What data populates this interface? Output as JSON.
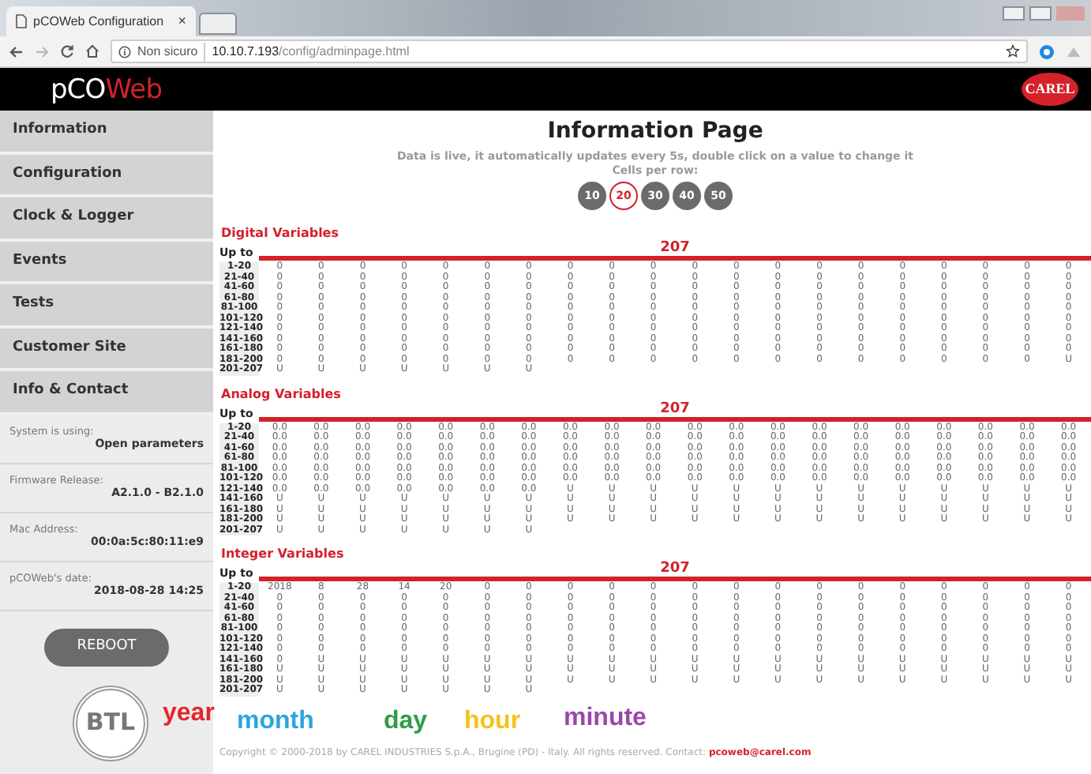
{
  "browser": {
    "tab_title": "pCOWeb Configuration",
    "tab_close": "×",
    "security_label": "Non sicuro",
    "url_host": "10.10.7.193",
    "url_path": "/config/adminpage.html"
  },
  "header": {
    "logo_part_1": "pCO",
    "logo_part_2": "Web",
    "brand_logo": "CAREL"
  },
  "sidebar": {
    "menu": [
      "Information",
      "Configuration",
      "Clock & Logger",
      "Events",
      "Tests",
      "Customer Site",
      "Info & Contact"
    ],
    "info": [
      {
        "label": "System is using:",
        "value": "Open parameters"
      },
      {
        "label": "Firmware Release:",
        "value": "A2.1.0 - B2.1.0"
      },
      {
        "label": "Mac Address:",
        "value": "00:0a:5c:80:11:e9"
      },
      {
        "label": "pCOWeb's date:",
        "value": "2018-08-28 14:25"
      }
    ],
    "reboot_button": "REBOOT",
    "badge_text": "BTL"
  },
  "page": {
    "title": "Information Page",
    "subtitle": "Data is live, it automatically updates every 5s, double click on a value to change it",
    "cells_label": "Cells per row:",
    "cells_per_row": [
      {
        "label": "10",
        "selected": false
      },
      {
        "label": "20",
        "selected": true
      },
      {
        "label": "30",
        "selected": false
      },
      {
        "label": "40",
        "selected": false
      },
      {
        "label": "50",
        "selected": false
      }
    ]
  },
  "tables": [
    {
      "title": "Digital Variables",
      "header_label": "Up to",
      "count": "207",
      "rows": [
        {
          "label": "1-20",
          "values": [
            "0",
            "0",
            "0",
            "0",
            "0",
            "0",
            "0",
            "0",
            "0",
            "0",
            "0",
            "0",
            "0",
            "0",
            "0",
            "0",
            "0",
            "0",
            "0",
            "0"
          ]
        },
        {
          "label": "21-40",
          "values": [
            "0",
            "0",
            "0",
            "0",
            "0",
            "0",
            "0",
            "0",
            "0",
            "0",
            "0",
            "0",
            "0",
            "0",
            "0",
            "0",
            "0",
            "0",
            "0",
            "0"
          ]
        },
        {
          "label": "41-60",
          "values": [
            "0",
            "0",
            "0",
            "0",
            "0",
            "0",
            "0",
            "0",
            "0",
            "0",
            "0",
            "0",
            "0",
            "0",
            "0",
            "0",
            "0",
            "0",
            "0",
            "0"
          ]
        },
        {
          "label": "61-80",
          "values": [
            "0",
            "0",
            "0",
            "0",
            "0",
            "0",
            "0",
            "0",
            "0",
            "0",
            "0",
            "0",
            "0",
            "0",
            "0",
            "0",
            "0",
            "0",
            "0",
            "0"
          ]
        },
        {
          "label": "81-100",
          "values": [
            "0",
            "0",
            "0",
            "0",
            "0",
            "0",
            "0",
            "0",
            "0",
            "0",
            "0",
            "0",
            "0",
            "0",
            "0",
            "0",
            "0",
            "0",
            "0",
            "0"
          ]
        },
        {
          "label": "101-120",
          "values": [
            "0",
            "0",
            "0",
            "0",
            "0",
            "0",
            "0",
            "0",
            "0",
            "0",
            "0",
            "0",
            "0",
            "0",
            "0",
            "0",
            "0",
            "0",
            "0",
            "0"
          ]
        },
        {
          "label": "121-140",
          "values": [
            "0",
            "0",
            "0",
            "0",
            "0",
            "0",
            "0",
            "0",
            "0",
            "0",
            "0",
            "0",
            "0",
            "0",
            "0",
            "0",
            "0",
            "0",
            "0",
            "0"
          ]
        },
        {
          "label": "141-160",
          "values": [
            "0",
            "0",
            "0",
            "0",
            "0",
            "0",
            "0",
            "0",
            "0",
            "0",
            "0",
            "0",
            "0",
            "0",
            "0",
            "0",
            "0",
            "0",
            "0",
            "0"
          ]
        },
        {
          "label": "161-180",
          "values": [
            "0",
            "0",
            "0",
            "0",
            "0",
            "0",
            "0",
            "0",
            "0",
            "0",
            "0",
            "0",
            "0",
            "0",
            "0",
            "0",
            "0",
            "0",
            "0",
            "0"
          ]
        },
        {
          "label": "181-200",
          "values": [
            "0",
            "0",
            "0",
            "0",
            "0",
            "0",
            "0",
            "0",
            "0",
            "0",
            "0",
            "0",
            "0",
            "0",
            "0",
            "0",
            "0",
            "0",
            "0",
            "U"
          ]
        },
        {
          "label": "201-207",
          "values": [
            "U",
            "U",
            "U",
            "U",
            "U",
            "U",
            "U"
          ]
        }
      ]
    },
    {
      "title": "Analog Variables",
      "header_label": "Up to",
      "count": "207",
      "rows": [
        {
          "label": "1-20",
          "values": [
            "0.0",
            "0.0",
            "0.0",
            "0.0",
            "0.0",
            "0.0",
            "0.0",
            "0.0",
            "0.0",
            "0.0",
            "0.0",
            "0.0",
            "0.0",
            "0.0",
            "0.0",
            "0.0",
            "0.0",
            "0.0",
            "0.0",
            "0.0"
          ]
        },
        {
          "label": "21-40",
          "values": [
            "0.0",
            "0.0",
            "0.0",
            "0.0",
            "0.0",
            "0.0",
            "0.0",
            "0.0",
            "0.0",
            "0.0",
            "0.0",
            "0.0",
            "0.0",
            "0.0",
            "0.0",
            "0.0",
            "0.0",
            "0.0",
            "0.0",
            "0.0"
          ]
        },
        {
          "label": "41-60",
          "values": [
            "0.0",
            "0.0",
            "0.0",
            "0.0",
            "0.0",
            "0.0",
            "0.0",
            "0.0",
            "0.0",
            "0.0",
            "0.0",
            "0.0",
            "0.0",
            "0.0",
            "0.0",
            "0.0",
            "0.0",
            "0.0",
            "0.0",
            "0.0"
          ]
        },
        {
          "label": "61-80",
          "values": [
            "0.0",
            "0.0",
            "0.0",
            "0.0",
            "0.0",
            "0.0",
            "0.0",
            "0.0",
            "0.0",
            "0.0",
            "0.0",
            "0.0",
            "0.0",
            "0.0",
            "0.0",
            "0.0",
            "0.0",
            "0.0",
            "0.0",
            "0.0"
          ]
        },
        {
          "label": "81-100",
          "values": [
            "0.0",
            "0.0",
            "0.0",
            "0.0",
            "0.0",
            "0.0",
            "0.0",
            "0.0",
            "0.0",
            "0.0",
            "0.0",
            "0.0",
            "0.0",
            "0.0",
            "0.0",
            "0.0",
            "0.0",
            "0.0",
            "0.0",
            "0.0"
          ]
        },
        {
          "label": "101-120",
          "values": [
            "0.0",
            "0.0",
            "0.0",
            "0.0",
            "0.0",
            "0.0",
            "0.0",
            "0.0",
            "0.0",
            "0.0",
            "0.0",
            "0.0",
            "0.0",
            "0.0",
            "0.0",
            "0.0",
            "0.0",
            "0.0",
            "0.0",
            "0.0"
          ]
        },
        {
          "label": "121-140",
          "values": [
            "0.0",
            "0.0",
            "0.0",
            "0.0",
            "0.0",
            "0.0",
            "0.0",
            "U",
            "U",
            "U",
            "U",
            "U",
            "U",
            "U",
            "U",
            "U",
            "U",
            "U",
            "U",
            "U"
          ]
        },
        {
          "label": "141-160",
          "values": [
            "U",
            "U",
            "U",
            "U",
            "U",
            "U",
            "U",
            "U",
            "U",
            "U",
            "U",
            "U",
            "U",
            "U",
            "U",
            "U",
            "U",
            "U",
            "U",
            "U"
          ]
        },
        {
          "label": "161-180",
          "values": [
            "U",
            "U",
            "U",
            "U",
            "U",
            "U",
            "U",
            "U",
            "U",
            "U",
            "U",
            "U",
            "U",
            "U",
            "U",
            "U",
            "U",
            "U",
            "U",
            "U"
          ]
        },
        {
          "label": "181-200",
          "values": [
            "U",
            "U",
            "U",
            "U",
            "U",
            "U",
            "U",
            "U",
            "U",
            "U",
            "U",
            "U",
            "U",
            "U",
            "U",
            "U",
            "U",
            "U",
            "U",
            "U"
          ]
        },
        {
          "label": "201-207",
          "values": [
            "U",
            "U",
            "U",
            "U",
            "U",
            "U",
            "U"
          ]
        }
      ]
    },
    {
      "title": "Integer Variables",
      "header_label": "Up to",
      "count": "207",
      "rows": [
        {
          "label": "1-20",
          "values": [
            "2018",
            "8",
            "28",
            "14",
            "20",
            "0",
            "0",
            "0",
            "0",
            "0",
            "0",
            "0",
            "0",
            "0",
            "0",
            "0",
            "0",
            "0",
            "0",
            "0"
          ]
        },
        {
          "label": "21-40",
          "values": [
            "0",
            "0",
            "0",
            "0",
            "0",
            "0",
            "0",
            "0",
            "0",
            "0",
            "0",
            "0",
            "0",
            "0",
            "0",
            "0",
            "0",
            "0",
            "0",
            "0"
          ]
        },
        {
          "label": "41-60",
          "values": [
            "0",
            "0",
            "0",
            "0",
            "0",
            "0",
            "0",
            "0",
            "0",
            "0",
            "0",
            "0",
            "0",
            "0",
            "0",
            "0",
            "0",
            "0",
            "0",
            "0"
          ]
        },
        {
          "label": "61-80",
          "values": [
            "0",
            "0",
            "0",
            "0",
            "0",
            "0",
            "0",
            "0",
            "0",
            "0",
            "0",
            "0",
            "0",
            "0",
            "0",
            "0",
            "0",
            "0",
            "0",
            "0"
          ]
        },
        {
          "label": "81-100",
          "values": [
            "0",
            "0",
            "0",
            "0",
            "0",
            "0",
            "0",
            "0",
            "0",
            "0",
            "0",
            "0",
            "0",
            "0",
            "0",
            "0",
            "0",
            "0",
            "0",
            "0"
          ]
        },
        {
          "label": "101-120",
          "values": [
            "0",
            "0",
            "0",
            "0",
            "0",
            "0",
            "0",
            "0",
            "0",
            "0",
            "0",
            "0",
            "0",
            "0",
            "0",
            "0",
            "0",
            "0",
            "0",
            "0"
          ]
        },
        {
          "label": "121-140",
          "values": [
            "0",
            "0",
            "0",
            "0",
            "0",
            "0",
            "0",
            "0",
            "0",
            "0",
            "0",
            "0",
            "0",
            "0",
            "0",
            "0",
            "0",
            "0",
            "0",
            "0"
          ]
        },
        {
          "label": "141-160",
          "values": [
            "0",
            "U",
            "U",
            "U",
            "U",
            "U",
            "U",
            "U",
            "U",
            "U",
            "U",
            "U",
            "U",
            "U",
            "U",
            "U",
            "U",
            "U",
            "U",
            "U"
          ]
        },
        {
          "label": "161-180",
          "values": [
            "U",
            "U",
            "U",
            "U",
            "U",
            "U",
            "U",
            "U",
            "U",
            "U",
            "U",
            "U",
            "U",
            "U",
            "U",
            "U",
            "U",
            "U",
            "U",
            "U"
          ]
        },
        {
          "label": "181-200",
          "values": [
            "U",
            "U",
            "U",
            "U",
            "U",
            "U",
            "U",
            "U",
            "U",
            "U",
            "U",
            "U",
            "U",
            "U",
            "U",
            "U",
            "U",
            "U",
            "U",
            "U"
          ]
        },
        {
          "label": "201-207",
          "values": [
            "U",
            "U",
            "U",
            "U",
            "U",
            "U",
            "U"
          ]
        }
      ]
    }
  ],
  "footer": {
    "copyright": "Copyright © 2000-2018 by CAREL INDUSTRIES S.p.A., Brugine (PD) - Italy. All rights reserved. Contact:",
    "email": "pcoweb@carel.com"
  },
  "annotations": [
    {
      "label": "year",
      "color": "#e3262d"
    },
    {
      "label": "month",
      "color": "#2aa6df"
    },
    {
      "label": "day",
      "color": "#2f9e46"
    },
    {
      "label": "hour",
      "color": "#f4c21a"
    },
    {
      "label": "minute",
      "color": "#9a48a8"
    }
  ]
}
